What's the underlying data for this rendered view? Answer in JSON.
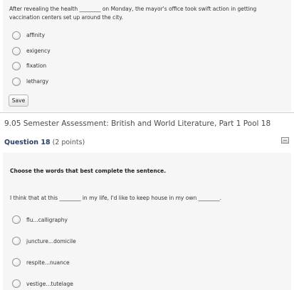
{
  "q17": {
    "text": "After revealing the health ________ on Monday, the mayor's office took swift action in getting vaccination centers set up around the city.",
    "options": [
      "affinity",
      "exigency",
      "fixation",
      "lethargy"
    ],
    "save_label": "Save"
  },
  "assessment": {
    "title": "9.05 Semester Assessment: British and World Literature, Part 1 Pool 18"
  },
  "q18": {
    "label": "Question 18",
    "points": "(2 points)",
    "instruction": "Choose the words that best complete the sentence.",
    "sentence": "I think that at this ________ in my life, I'd like to keep house in my own ________.",
    "options": [
      "flu...calligraphy",
      "juncture...domicile",
      "respite...nuance",
      "vestige...tutelage"
    ]
  }
}
